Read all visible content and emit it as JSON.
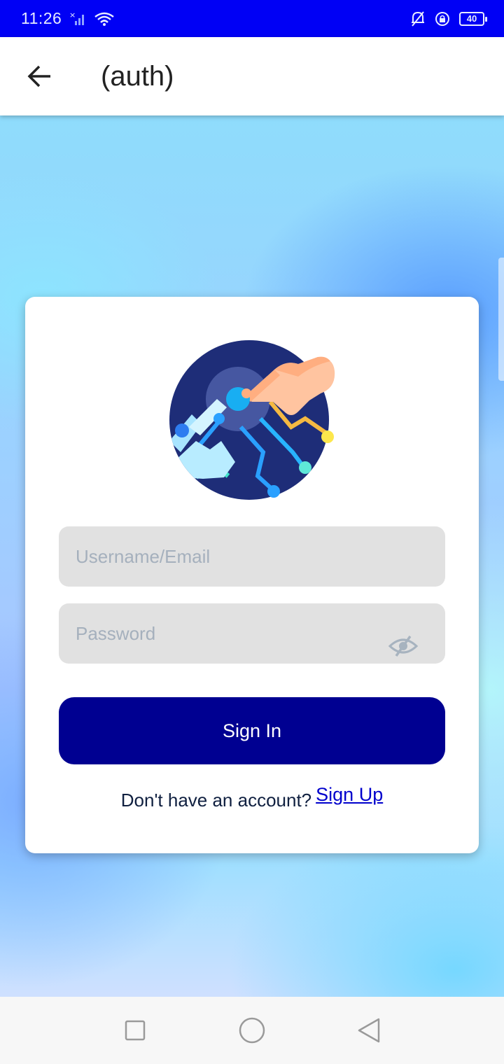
{
  "status_bar": {
    "time": "11:26",
    "battery": "40"
  },
  "app_bar": {
    "title": "(auth)"
  },
  "login_form": {
    "username_placeholder": "Username/Email",
    "password_placeholder": "Password",
    "sign_in_label": "Sign In",
    "no_account_text": "Don't have an account?",
    "sign_up_label": "Sign Up"
  },
  "colors": {
    "status_bar": "#0000f5",
    "primary_button": "#000091",
    "link": "#0000cc",
    "input_bg": "#e1e1e1"
  },
  "icons": {
    "back": "arrow-left-icon",
    "password_toggle": "eye-off-icon",
    "nav": [
      "square-recents-icon",
      "circle-home-icon",
      "triangle-back-icon"
    ]
  }
}
